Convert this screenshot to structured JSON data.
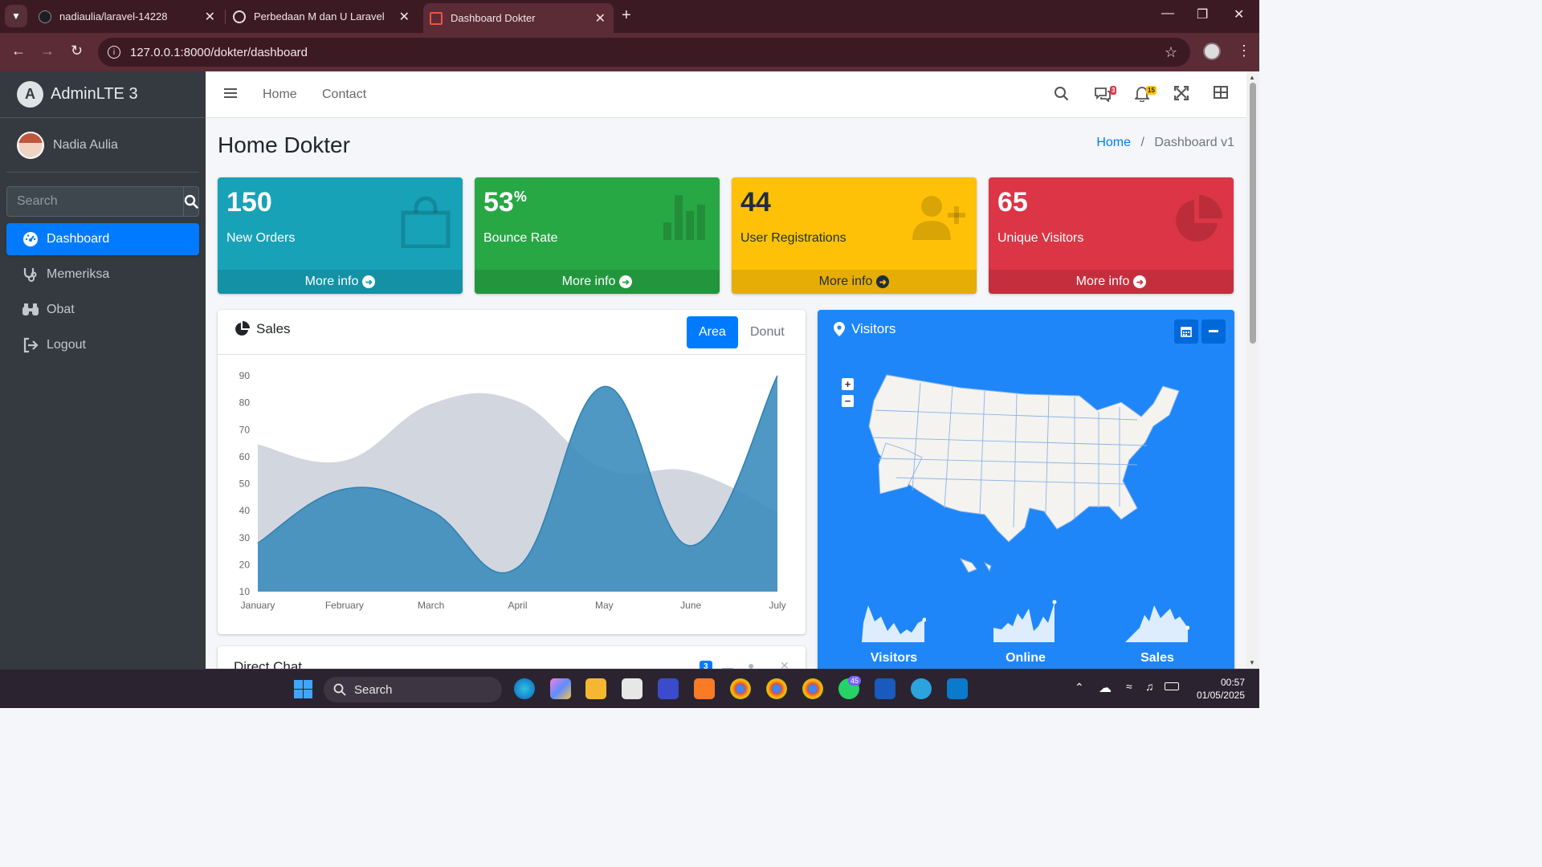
{
  "browser": {
    "tabs": [
      {
        "title": "nadiaulia/laravel-14228",
        "active": false
      },
      {
        "title": "Perbedaan M dan U Laravel",
        "active": false
      },
      {
        "title": "Dashboard Dokter",
        "active": true
      }
    ],
    "url": "127.0.0.1:8000/dokter/dashboard"
  },
  "sidebar": {
    "brand": "AdminLTE 3",
    "user": "Nadia Aulia",
    "search_placeholder": "Search",
    "items": [
      {
        "label": "Dashboard",
        "icon": "tachometer-icon",
        "active": true
      },
      {
        "label": "Memeriksa",
        "icon": "stethoscope-icon",
        "active": false
      },
      {
        "label": "Obat",
        "icon": "binoculars-icon",
        "active": false
      },
      {
        "label": "Logout",
        "icon": "logout-icon",
        "active": false
      }
    ]
  },
  "topnav": {
    "links": [
      "Home",
      "Contact"
    ],
    "messages_badge": "3",
    "notifications_badge": "15"
  },
  "page": {
    "title": "Home Dokter",
    "breadcrumb_home": "Home",
    "breadcrumb_current": "Dashboard v1"
  },
  "stats": [
    {
      "value": "150",
      "suffix": "",
      "label": "New Orders",
      "link": "More info",
      "color": "#17a2b8",
      "icon": "shopping-bag-icon"
    },
    {
      "value": "53",
      "suffix": "%",
      "label": "Bounce Rate",
      "link": "More info",
      "color": "#28a745",
      "icon": "bar-chart-icon"
    },
    {
      "value": "44",
      "suffix": "",
      "label": "User Registrations",
      "link": "More info",
      "color": "#ffc107",
      "icon": "user-plus-icon"
    },
    {
      "value": "65",
      "suffix": "",
      "label": "Unique Visitors",
      "link": "More info",
      "color": "#dc3545",
      "icon": "pie-chart-icon"
    }
  ],
  "sales": {
    "title": "Sales",
    "tabs": [
      "Area",
      "Donut"
    ],
    "active_tab": "Area"
  },
  "visitors": {
    "title": "Visitors",
    "sparklines": [
      "Visitors",
      "Online",
      "Sales"
    ]
  },
  "direct_chat": {
    "title": "Direct Chat",
    "badge": "3"
  },
  "taskbar": {
    "search": "Search",
    "time": "00:57",
    "date": "01/05/2025",
    "whatsapp_badge": "45"
  },
  "chart_data": {
    "type": "area",
    "categories": [
      "January",
      "February",
      "March",
      "April",
      "May",
      "June",
      "July"
    ],
    "ylim": [
      10,
      90
    ],
    "yticks": [
      10,
      20,
      30,
      40,
      50,
      60,
      70,
      80,
      90
    ],
    "series": [
      {
        "values": [
          28,
          48,
          40,
          19,
          86,
          27,
          90
        ],
        "color": "#3c8dbc"
      },
      {
        "values": [
          65,
          59,
          80,
          81,
          56,
          55,
          40
        ],
        "color": "#d2d6de"
      }
    ],
    "grid": false
  }
}
